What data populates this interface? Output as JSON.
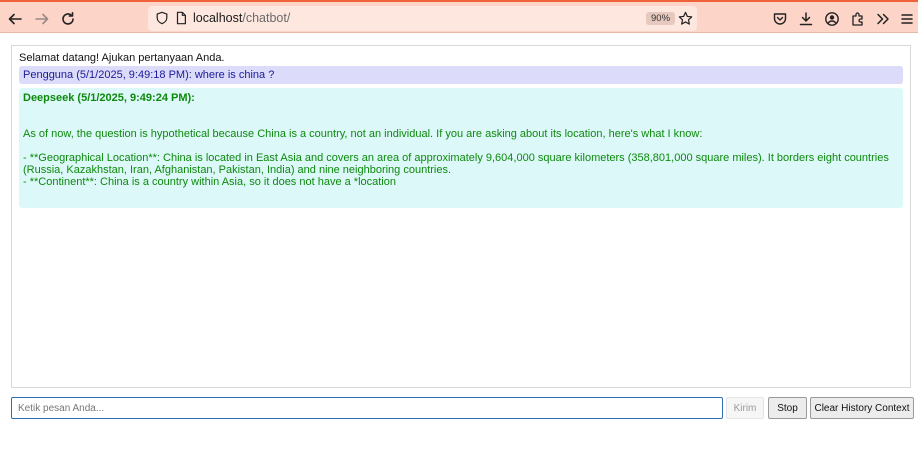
{
  "browser": {
    "url_host": "localhost",
    "url_path": "/chatbot/",
    "zoom": "90%"
  },
  "chat": {
    "welcome": "Selamat datang! Ajukan pertanyaan Anda.",
    "user_message": "Pengguna (5/1/2025, 9:49:18 PM): where is china ?",
    "bot_header": "Deepseek (5/1/2025, 9:49:24 PM):",
    "bot_paragraph_1": "As of now, the question is hypothetical because China is a country, not an individual. If you are asking about its location, here's what I know:",
    "bot_paragraph_2": "- **Geographical Location**: China is located in East Asia and covers an area of approximately 9,604,000 square kilometers (358,801,000 square miles). It borders eight countries (Russia, Kazakhstan, Iran, Afghanistan, Pakistan, India) and nine neighboring countries.",
    "bot_paragraph_3": "- **Continent**: China is a country within Asia, so it does not have a *location"
  },
  "input": {
    "placeholder": "Ketik pesan Anda...",
    "value": ""
  },
  "buttons": {
    "send": "Kirim",
    "stop": "Stop",
    "clear": "Clear History Context"
  },
  "colors": {
    "toolbar_bg": "#fcd5c8",
    "user_bg": "#dcdcfa",
    "user_text": "#1a1a9a",
    "bot_bg": "#dcf8f8",
    "bot_text": "#0d8a0d"
  }
}
